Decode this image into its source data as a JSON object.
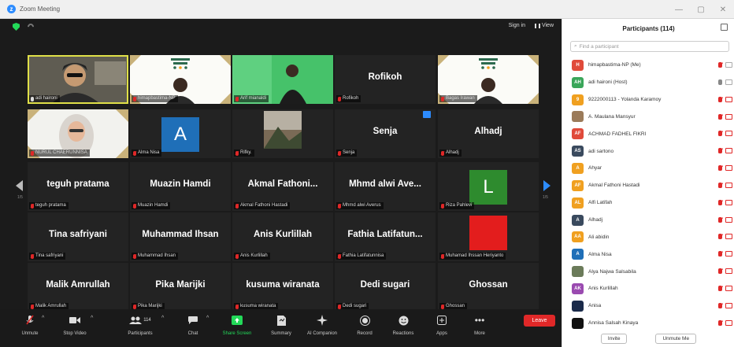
{
  "window": {
    "title": "Zoom Meeting"
  },
  "topbar": {
    "sign_in": "Sign in",
    "view": "View"
  },
  "tiles": [
    {
      "name": "",
      "label": "adi haironi",
      "kind": "video-person",
      "mic": "on",
      "active": true
    },
    {
      "name": "",
      "label": "himapbastima-NP",
      "kind": "video-banner",
      "mic": "off"
    },
    {
      "name": "",
      "label": "Arif mianaldi",
      "kind": "video-green",
      "mic": "off"
    },
    {
      "name": "Rofikoh",
      "label": "Rofikoh",
      "kind": "name",
      "mic": "off"
    },
    {
      "name": "",
      "label": "Bagas Irawan",
      "kind": "video-banner",
      "mic": "off"
    },
    {
      "name": "",
      "label": "NURUL CHAERUNNISA",
      "kind": "video-hijab",
      "mic": "off"
    },
    {
      "name": "",
      "label": "Alma Nisa",
      "kind": "avatar",
      "avatar_letter": "A",
      "avatar_color": "#1f6fb8",
      "mic": "off"
    },
    {
      "name": "",
      "label": "Rifky.",
      "kind": "video-photo",
      "mic": "off"
    },
    {
      "name": "Senja",
      "label": "Senja",
      "kind": "name",
      "mic": "off"
    },
    {
      "name": "Alhadj",
      "label": "Alhadj",
      "kind": "name",
      "mic": "off"
    },
    {
      "name": "teguh pratama",
      "label": "teguh pratama",
      "kind": "name",
      "mic": "off"
    },
    {
      "name": "Muazin Hamdi",
      "label": "Muazin Hamdi",
      "kind": "name",
      "mic": "off"
    },
    {
      "name": "Akmal Fathoni...",
      "label": "Akmal Fathoni Hastadi",
      "kind": "name",
      "mic": "off"
    },
    {
      "name": "Mhmd alwi Ave...",
      "label": "Mhmd alwi Averus",
      "kind": "name",
      "mic": "off"
    },
    {
      "name": "",
      "label": "Riza Pahlevi",
      "kind": "avatar",
      "avatar_letter": "L",
      "avatar_color": "#2e8b2e",
      "mic": "off"
    },
    {
      "name": "Tina safriyani",
      "label": "Tina safriyani",
      "kind": "name",
      "mic": "off"
    },
    {
      "name": "Muhammad Ihsan",
      "label": "Muhammad Ihsan",
      "kind": "name",
      "mic": "off"
    },
    {
      "name": "Anis Kurlillah",
      "label": "Anis Kurlillah",
      "kind": "name",
      "mic": "off"
    },
    {
      "name": "Fathia Latifatun...",
      "label": "Fathia Latifatunnisa",
      "kind": "name",
      "mic": "off"
    },
    {
      "name": "",
      "label": "Muhamad Ihssan Heriyanto",
      "kind": "red",
      "mic": "off"
    },
    {
      "name": "Malik Amrullah",
      "label": "Malik Amrullah",
      "kind": "name",
      "mic": "off"
    },
    {
      "name": "Pika Marijki",
      "label": "Pika Marijki",
      "kind": "name",
      "mic": "off"
    },
    {
      "name": "kusuma wiranata",
      "label": "kusuma wiranata",
      "kind": "name",
      "mic": "off"
    },
    {
      "name": "Dedi sugari",
      "label": "Dedi sugari",
      "kind": "name",
      "mic": "off"
    },
    {
      "name": "Ghossan",
      "label": "Ghossan",
      "kind": "name",
      "mic": "off"
    }
  ],
  "pager": {
    "left": "1/5",
    "right": "1/5"
  },
  "toolbar": {
    "unmute": "Unmute",
    "stop_video": "Stop Video",
    "participants": "Participants",
    "participants_count": "114",
    "chat": "Chat",
    "share_screen": "Share Screen",
    "summary": "Summary",
    "ai_companion": "AI Companion",
    "record": "Record",
    "reactions": "Reactions",
    "apps": "Apps",
    "more": "More",
    "leave": "Leave"
  },
  "panel": {
    "title": "Participants (114)",
    "search_placeholder": "Find a participant",
    "invite": "Invite",
    "unmute_me": "Unmute Me",
    "participants": [
      {
        "initials": "H",
        "color": "#e04a3a",
        "name": "himapbastima-NP (Me)",
        "mic": "off",
        "video": "off"
      },
      {
        "initials": "AH",
        "color": "#3aa65a",
        "name": "adi haironi (Host)",
        "mic": "on",
        "video": "off"
      },
      {
        "initials": "9",
        "color": "#f0a020",
        "name": "9222000113 - Yolanda Karamoy",
        "mic": "off",
        "video": "on"
      },
      {
        "initials": "",
        "color": "#9b7b5a",
        "name": "A. Maulana Mansyur",
        "mic": "off",
        "video": "on"
      },
      {
        "initials": "AF",
        "color": "#e04a3a",
        "name": "ACHMAD FADHEL FIKRI",
        "mic": "off",
        "video": "on"
      },
      {
        "initials": "AS",
        "color": "#3a4a5e",
        "name": "adi sartono",
        "mic": "off",
        "video": "on"
      },
      {
        "initials": "A",
        "color": "#f0a020",
        "name": "Ahyar",
        "mic": "off",
        "video": "on"
      },
      {
        "initials": "AF",
        "color": "#f0a020",
        "name": "Akmal Fathoni Hastadi",
        "mic": "off",
        "video": "on"
      },
      {
        "initials": "AL",
        "color": "#f0a020",
        "name": "Alfi Latifah",
        "mic": "off",
        "video": "on"
      },
      {
        "initials": "A",
        "color": "#3a4a5e",
        "name": "Alhadj",
        "mic": "off",
        "video": "on"
      },
      {
        "initials": "AA",
        "color": "#f0a020",
        "name": "Ali abidin",
        "mic": "off",
        "video": "on"
      },
      {
        "initials": "A",
        "color": "#1f6fb8",
        "name": "Alma Nisa",
        "mic": "off",
        "video": "on"
      },
      {
        "initials": "",
        "color": "#6b7b5a",
        "name": "Alya Najwa Salsabila",
        "mic": "off",
        "video": "on"
      },
      {
        "initials": "AK",
        "color": "#9a4ab0",
        "name": "Anis Kurlillah",
        "mic": "off",
        "video": "on"
      },
      {
        "initials": "",
        "color": "#1a2a4a",
        "name": "Anisa",
        "mic": "off",
        "video": "on"
      },
      {
        "initials": "",
        "color": "#111111",
        "name": "Annisa Salsah Kinaya",
        "mic": "off",
        "video": "on"
      }
    ]
  }
}
